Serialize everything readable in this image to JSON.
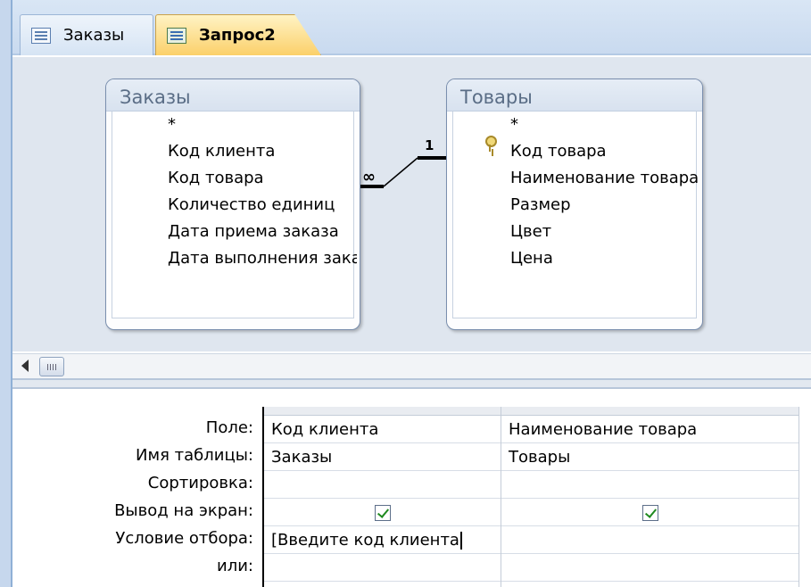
{
  "tabs": [
    {
      "label": "Заказы",
      "icon": "table-icon",
      "active": false
    },
    {
      "label": "Запрос2",
      "icon": "query-icon",
      "active": true
    }
  ],
  "tables": {
    "orders": {
      "title": "Заказы",
      "fields": [
        "*",
        "Код клиента",
        "Код товара",
        "Количество единиц",
        "Дата приема заказа",
        "Дата выполнения заказа"
      ]
    },
    "goods": {
      "title": "Товары",
      "fields": [
        "*",
        "Код товара",
        "Наименование товара",
        "Размер",
        "Цвет",
        "Цена"
      ],
      "primary_key_icon": "key-icon"
    }
  },
  "relation": {
    "many": "∞",
    "one": "1"
  },
  "grid": {
    "row_labels": [
      "Поле:",
      "Имя таблицы:",
      "Сортировка:",
      "Вывод на экран:",
      "Условие отбора:",
      "или:"
    ],
    "columns": [
      {
        "field": "Код клиента",
        "table": "Заказы",
        "sort": "",
        "show": true,
        "criteria": "[Введите код клиента",
        "or": ""
      },
      {
        "field": "Наименование товара",
        "table": "Товары",
        "sort": "",
        "show": true,
        "criteria": "",
        "or": ""
      }
    ]
  },
  "colors": {
    "active_tab": "#fbd06a",
    "design_background": "#dfe6ef",
    "checkmark": "#1f8a1f"
  }
}
